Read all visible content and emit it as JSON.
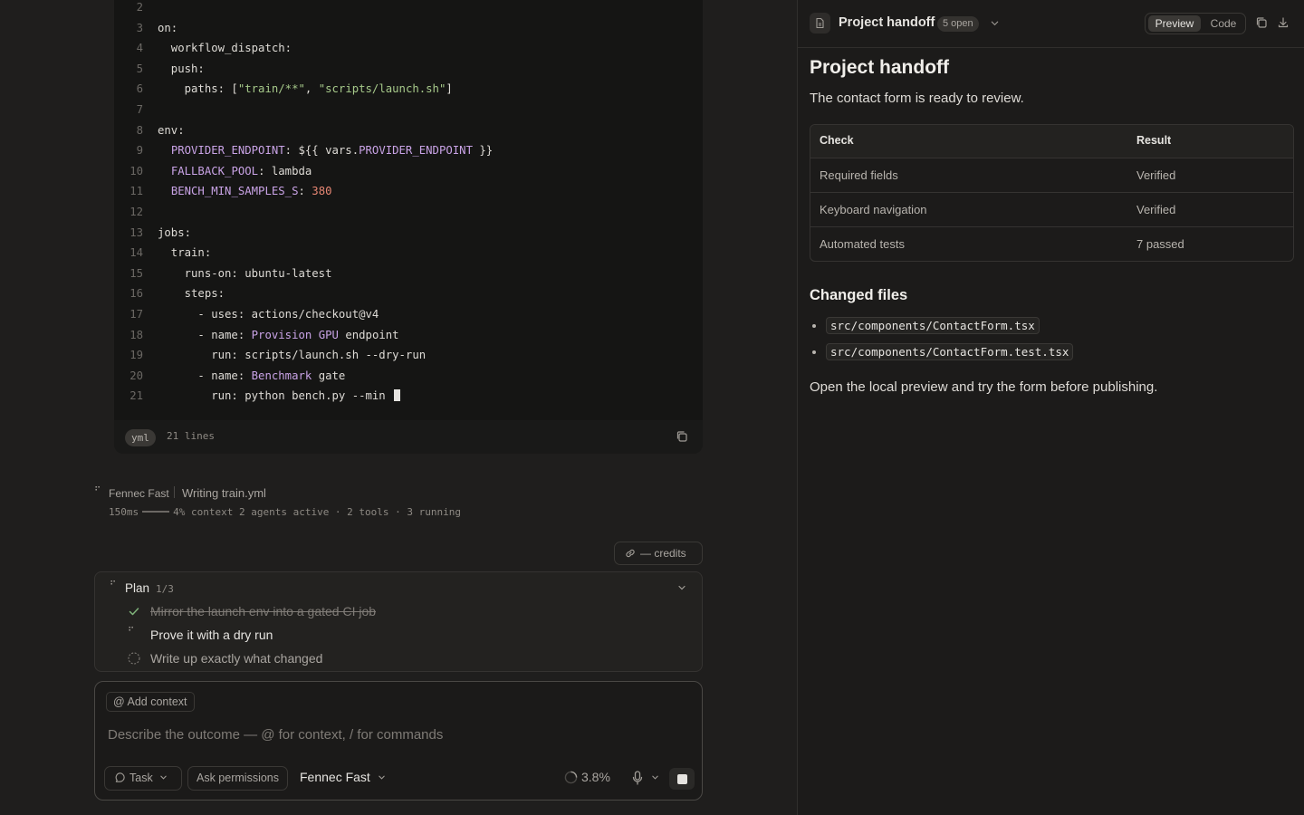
{
  "editor": {
    "lines": [
      {
        "n": "2",
        "html": ""
      },
      {
        "n": "3",
        "html": "on:"
      },
      {
        "n": "4",
        "html": "  workflow_dispatch:"
      },
      {
        "n": "5",
        "html": "  push:"
      },
      {
        "n": "6",
        "html": "    paths: [<span class=\"k-str\">\"train/**\"</span>, <span class=\"k-str\">\"scripts/launch.sh\"</span>]"
      },
      {
        "n": "7",
        "html": ""
      },
      {
        "n": "8",
        "html": "env:"
      },
      {
        "n": "9",
        "html": "  <span class=\"k-var\">PROVIDER_ENDPOINT</span>: ${{ vars.<span class=\"k-var\">PROVIDER_ENDPOINT</span> }}"
      },
      {
        "n": "10",
        "html": "  <span class=\"k-var\">FALLBACK_POOL</span>: lambda"
      },
      {
        "n": "11",
        "html": "  <span class=\"k-var\">BENCH_MIN_SAMPLES_S</span>: <span class=\"k-num\">380</span>"
      },
      {
        "n": "12",
        "html": ""
      },
      {
        "n": "13",
        "html": "jobs:"
      },
      {
        "n": "14",
        "html": "  train:"
      },
      {
        "n": "15",
        "html": "    runs-on: ubuntu-latest"
      },
      {
        "n": "16",
        "html": "    steps:"
      },
      {
        "n": "17",
        "html": "      - uses: actions/checkout@v4"
      },
      {
        "n": "18",
        "html": "      - name: <span class=\"k-var\">Provision</span> <span class=\"k-var\">GPU</span> endpoint"
      },
      {
        "n": "19",
        "html": "        run: scripts/launch.sh --dry-run"
      },
      {
        "n": "20",
        "html": "      - name: <span class=\"k-var\">Benchmark</span> gate"
      },
      {
        "n": "21",
        "html": "        run: python bench.py --min <span class=\"cursor\"></span>"
      }
    ],
    "language": "yml",
    "line_count": "21 lines"
  },
  "status": {
    "agent": "Fennec Fast",
    "action": "Writing train.yml",
    "latency": "150ms",
    "meta": "4% context 2 agents active · 2 tools · 3 running"
  },
  "credits": {
    "label": "— credits"
  },
  "plan": {
    "title": "Plan",
    "count": "1/3",
    "items": [
      {
        "label": "Mirror the launch env into a gated CI job",
        "state": "done"
      },
      {
        "label": "Prove it with a dry run",
        "state": "active"
      },
      {
        "label": "Write up exactly what changed",
        "state": "todo"
      }
    ]
  },
  "composer": {
    "add_context": "Add context",
    "placeholder": "Describe the outcome — @ for context, / for commands",
    "task": "Task",
    "permissions": "Ask permissions",
    "model": "Fennec Fast",
    "usage": "3.8%"
  },
  "panel": {
    "title": "Project handoff",
    "open_badge": "5 open",
    "tabs": {
      "preview": "Preview",
      "code": "Code"
    }
  },
  "doc": {
    "heading": "Project handoff",
    "intro": "The contact form is ready to review.",
    "table": {
      "headers": [
        "Check",
        "Result"
      ],
      "rows": [
        [
          "Required fields",
          "Verified"
        ],
        [
          "Keyboard navigation",
          "Verified"
        ],
        [
          "Automated tests",
          "7 passed"
        ]
      ]
    },
    "changed_heading": "Changed files",
    "files": [
      "src/components/ContactForm.tsx",
      "src/components/ContactForm.test.tsx"
    ],
    "outro": "Open the local preview and try the form before publishing."
  },
  "icons": {
    "copy": "copy-icon",
    "download": "download-icon",
    "doc": "document-icon",
    "chevron": "chevron-down-icon",
    "check": "check-icon",
    "mic": "microphone-icon",
    "stop": "stop-icon",
    "chat": "chat-bubble-icon",
    "link": "link-icon"
  },
  "colors": {
    "accent_check": "#7fb37a",
    "background": "#1f1e1d"
  }
}
